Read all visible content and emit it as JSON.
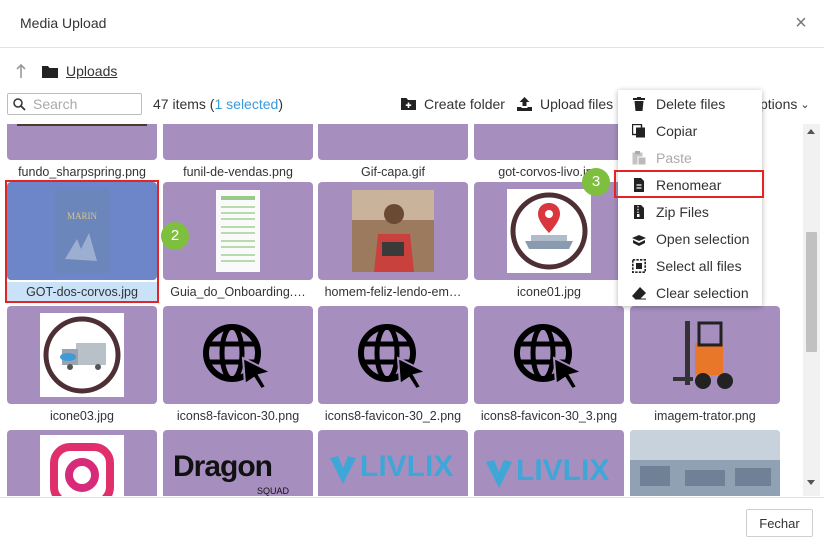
{
  "dialog": {
    "title": "Media Upload",
    "close_symbol": "×"
  },
  "breadcrumb": {
    "folder": "Uploads"
  },
  "toolbar": {
    "search_placeholder": "Search",
    "items_count": "47 items",
    "selected_open": " (",
    "selected_text": "1 selected",
    "selected_close": ")",
    "create_folder": "Create folder",
    "upload_files": "Upload files",
    "options": "ptions",
    "options_chevron": "⌄"
  },
  "grid": {
    "row1": [
      "fundo_sharpspring.png",
      "funil-de-vendas.png",
      "Gif-capa.gif",
      "got-corvos-livo.jpg"
    ],
    "row2": [
      "GOT-dos-corvos.jpg",
      "Guia_do_Onboarding.…",
      "homem-feliz-lendo-em…",
      "icone01.jpg"
    ],
    "row3": [
      "icone03.jpg",
      "icons8-favicon-30.png",
      "icons8-favicon-30_2.png",
      "icons8-favicon-30_3.png",
      "imagem-trator.png"
    ],
    "row4_text": {
      "dragon": "Dragon",
      "squad": "SQUAD",
      "livlix1": "LIVLIX",
      "livlix2": "LIVLIX"
    },
    "book_text": "MARIN"
  },
  "badges": {
    "b2": "2",
    "b3": "3"
  },
  "context_menu": [
    {
      "label": "Delete files",
      "icon": "trash-icon",
      "disabled": false
    },
    {
      "label": "Copiar",
      "icon": "copy-icon",
      "disabled": false
    },
    {
      "label": "Paste",
      "icon": "paste-icon",
      "disabled": true
    },
    {
      "label": "Renomear",
      "icon": "file-icon",
      "disabled": false
    },
    {
      "label": "Zip Files",
      "icon": "zip-icon",
      "disabled": false
    },
    {
      "label": "Open selection",
      "icon": "open-selection-icon",
      "disabled": false
    },
    {
      "label": "Select all files",
      "icon": "select-all-icon",
      "disabled": false
    },
    {
      "label": "Clear selection",
      "icon": "eraser-icon",
      "disabled": false
    }
  ],
  "footer": {
    "close_label": "Fechar"
  },
  "colors": {
    "tile": "#a68fbf",
    "selected_tile": "#6d86c9",
    "selected_label": "#c9e2f7",
    "highlight": "#e32424",
    "badge": "#7fbf3f",
    "link": "#3a9ad9"
  }
}
